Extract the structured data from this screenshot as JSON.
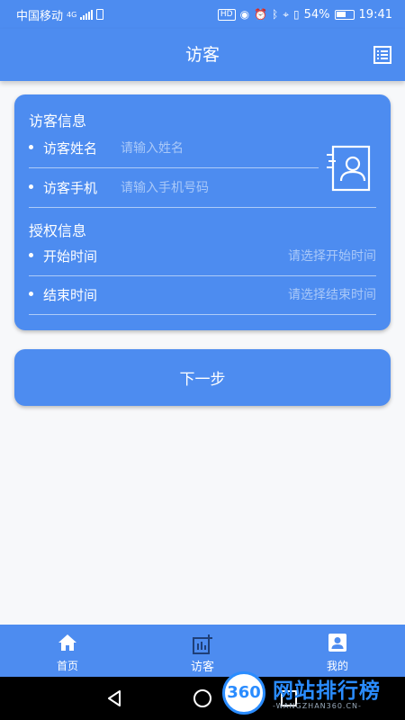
{
  "status_bar": {
    "carrier": "中国移动",
    "network": "4G",
    "hd": "HD",
    "battery_percent": "54%",
    "time": "19:41"
  },
  "header": {
    "title": "访客",
    "right_icon": "list-icon"
  },
  "visitor_section": {
    "title": "访客信息",
    "name_label": "访客姓名",
    "name_placeholder": "请输入姓名",
    "name_value": "",
    "phone_label": "访客手机",
    "phone_placeholder": "请输入手机号码",
    "phone_value": ""
  },
  "auth_section": {
    "title": "授权信息",
    "start_label": "开始时间",
    "start_placeholder": "请选择开始时间",
    "end_label": "结束时间",
    "end_placeholder": "请选择结束时间"
  },
  "next_button": "下一步",
  "bottom_nav": {
    "items": [
      {
        "label": "首页",
        "icon": "home-icon"
      },
      {
        "label": "访客",
        "icon": "visitor-icon"
      },
      {
        "label": "我的",
        "icon": "profile-icon"
      }
    ],
    "active": "访客"
  },
  "watermark": {
    "number": "360",
    "text": "网站排行榜",
    "sub": "-WANGZHAN360.CN-"
  },
  "colors": {
    "primary": "#4d8cf0",
    "background": "#f7f8fa",
    "placeholder": "#a9c8f8"
  }
}
